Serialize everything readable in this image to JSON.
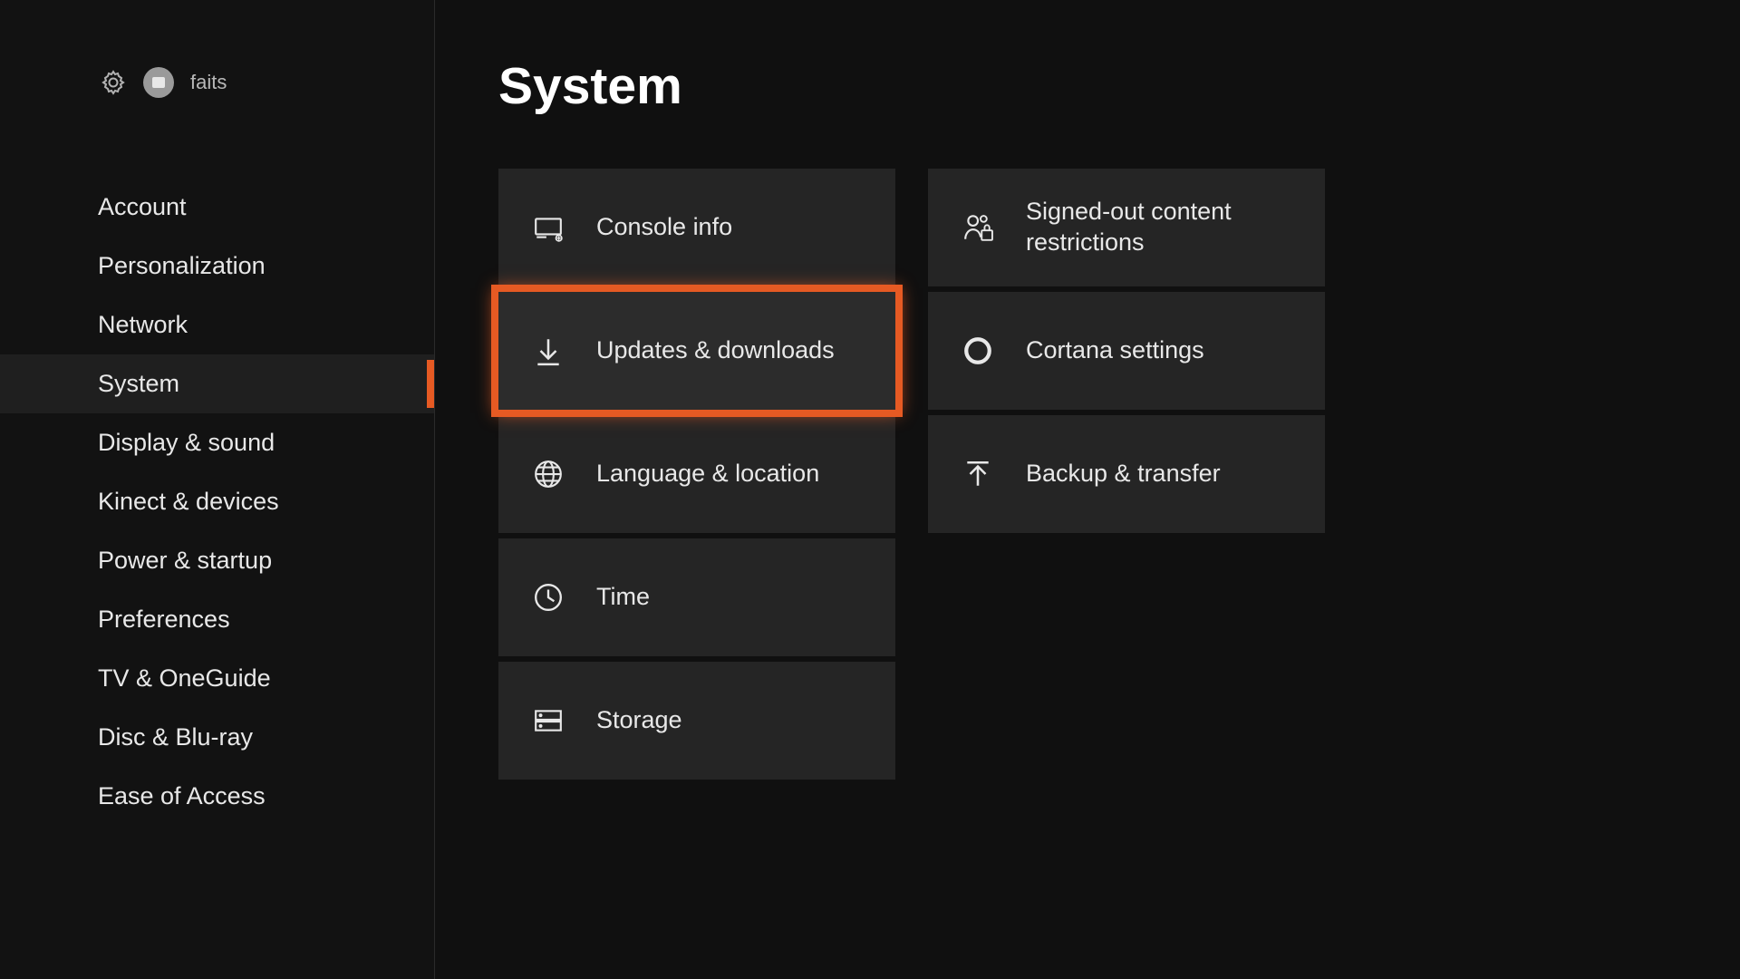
{
  "header": {
    "username": "faits"
  },
  "sidebar": {
    "items": [
      {
        "label": "Account"
      },
      {
        "label": "Personalization"
      },
      {
        "label": "Network"
      },
      {
        "label": "System",
        "active": true
      },
      {
        "label": "Display & sound"
      },
      {
        "label": "Kinect & devices"
      },
      {
        "label": "Power & startup"
      },
      {
        "label": "Preferences"
      },
      {
        "label": "TV & OneGuide"
      },
      {
        "label": "Disc & Blu-ray"
      },
      {
        "label": "Ease of Access"
      }
    ]
  },
  "main": {
    "title": "System",
    "col1": [
      {
        "name": "console-info",
        "icon": "console-icon",
        "label": "Console info"
      },
      {
        "name": "updates-downloads",
        "icon": "download-icon",
        "label": "Updates & downloads",
        "highlighted": true
      },
      {
        "name": "language-location",
        "icon": "globe-icon",
        "label": "Language & location"
      },
      {
        "name": "time",
        "icon": "clock-icon",
        "label": "Time"
      },
      {
        "name": "storage",
        "icon": "storage-icon",
        "label": "Storage"
      }
    ],
    "col2": [
      {
        "name": "signedout-restrictions",
        "icon": "people-lock-icon",
        "label": "Signed-out content restrictions"
      },
      {
        "name": "cortana-settings",
        "icon": "ring-icon",
        "label": "Cortana settings"
      },
      {
        "name": "backup-transfer",
        "icon": "upload-icon",
        "label": "Backup & transfer"
      }
    ]
  }
}
